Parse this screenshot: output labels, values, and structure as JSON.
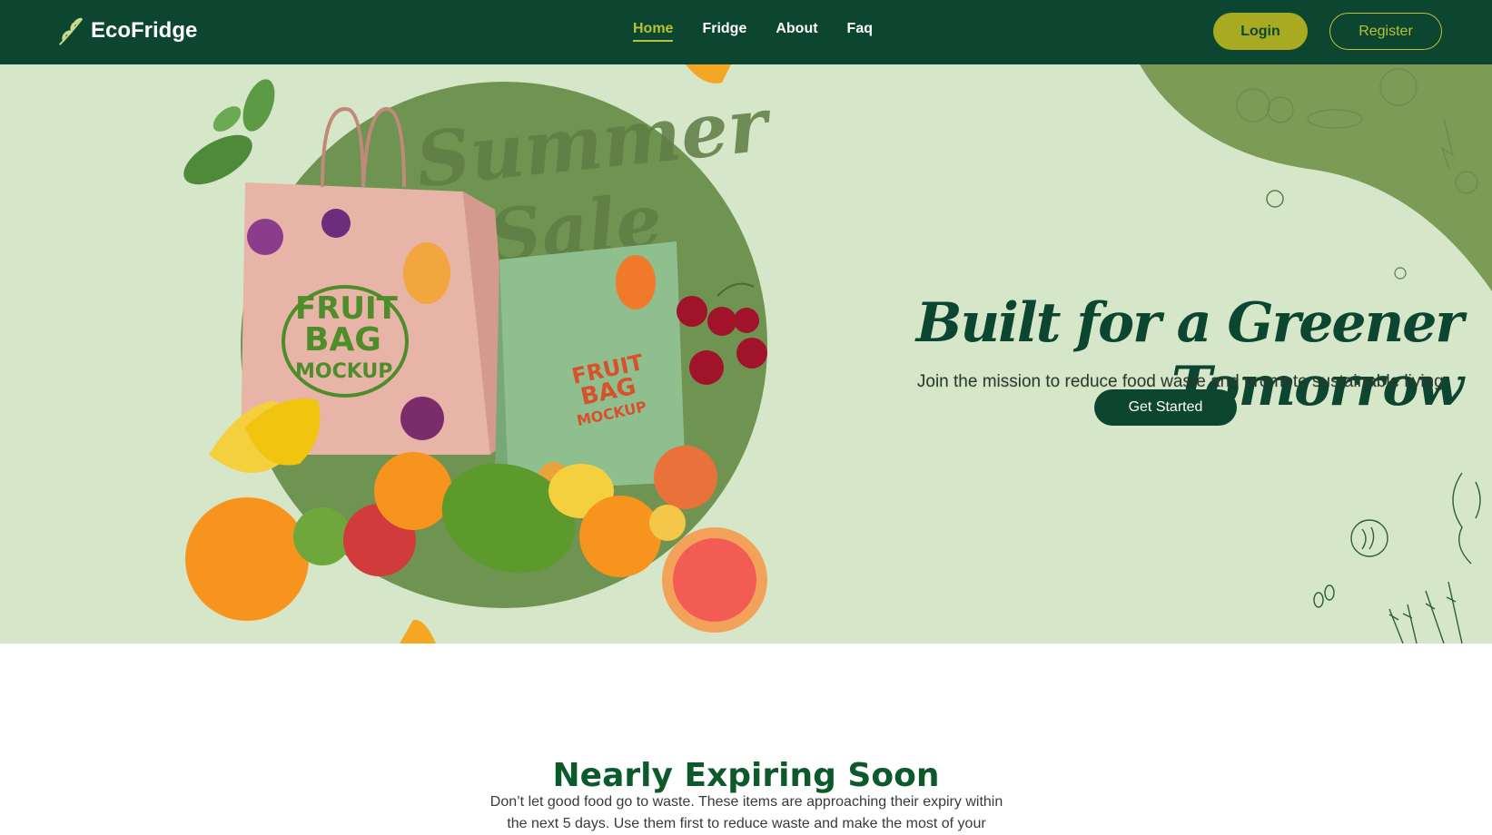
{
  "brand": {
    "name": "EcoFridge",
    "logo_icon": "leaf-sprig-icon"
  },
  "nav": {
    "links": [
      {
        "label": "Home",
        "active": true
      },
      {
        "label": "Fridge",
        "active": false
      },
      {
        "label": "About",
        "active": false
      },
      {
        "label": "Faq",
        "active": false
      }
    ],
    "login_label": "Login",
    "register_label": "Register"
  },
  "hero": {
    "title": "Built for a Greener Tomorrow",
    "subtitle": "Join the mission to reduce food waste and promote sustainable living.",
    "cta_label": "Get Started",
    "image": {
      "promo_text_line1": "Summer",
      "promo_text_line2": "Sale",
      "bag1_text_line1": "FRUIT",
      "bag1_text_line2": "BAG",
      "bag1_text_line3": "MOCKUP",
      "bag2_text_line1": "FRUIT",
      "bag2_text_line2": "BAG",
      "bag2_text_line3": "MOCKUP"
    }
  },
  "expiring": {
    "title": "Nearly Expiring Soon",
    "description": "Don’t let good food go to waste. These items are approaching their expiry within the next 5 days. Use them first to reduce waste and make the most of your"
  },
  "colors": {
    "nav_bg": "#0c4630",
    "accent": "#a8ab22",
    "hero_bg": "#d6e7c9",
    "hero_blob": "#7b9b57",
    "section_title": "#0c5a2c"
  }
}
